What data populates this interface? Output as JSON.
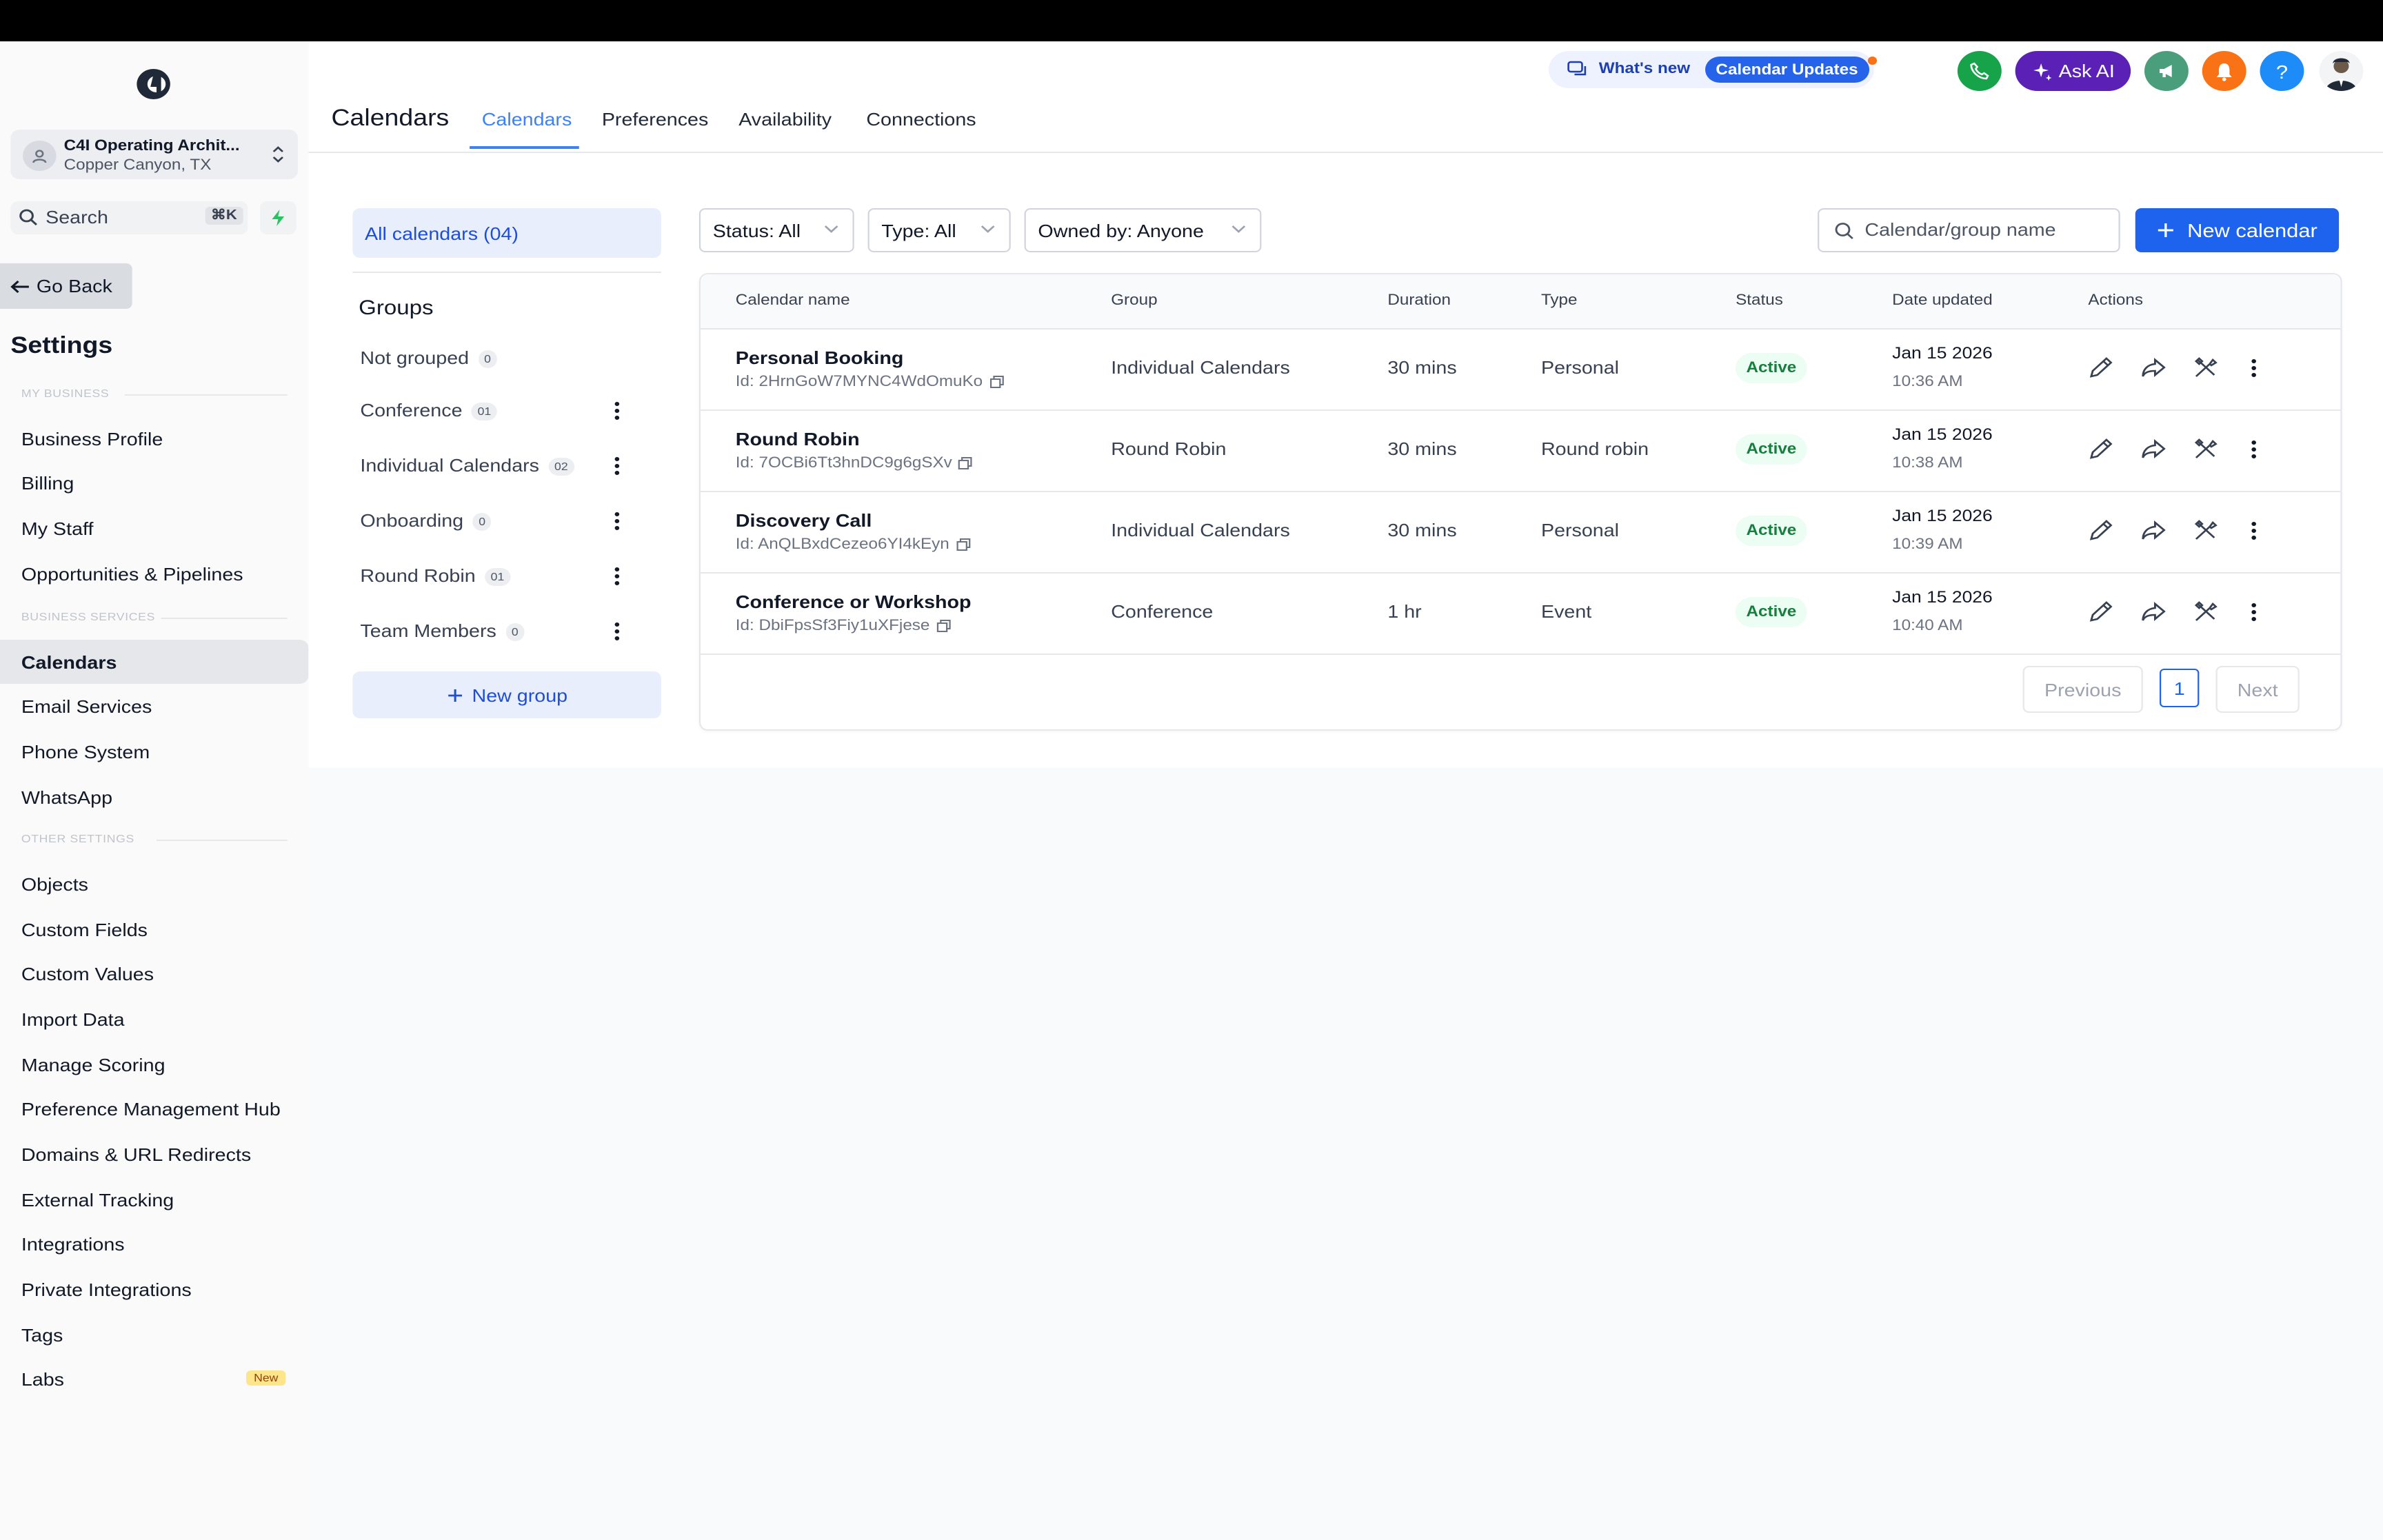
{
  "account": {
    "name": "C4I Operating Archit...",
    "location": "Copper Canyon, TX"
  },
  "search": {
    "label": "Search",
    "shortcut": "⌘K"
  },
  "sidebar": {
    "go_back": "Go Back",
    "title": "Settings",
    "sections": [
      {
        "label": "MY BUSINESS",
        "items": [
          "Business Profile",
          "Billing",
          "My Staff",
          "Opportunities & Pipelines"
        ]
      },
      {
        "label": "BUSINESS SERVICES",
        "items": [
          "Calendars",
          "Email Services",
          "Phone System",
          "WhatsApp"
        ]
      },
      {
        "label": "OTHER SETTINGS",
        "items": [
          "Objects",
          "Custom Fields",
          "Custom Values",
          "Import Data",
          "Manage Scoring",
          "Preference Management Hub",
          "Domains & URL Redirects",
          "External Tracking",
          "Integrations",
          "Private Integrations",
          "Tags",
          "Labs"
        ]
      }
    ],
    "active_item": "Calendars",
    "labs_badge": "New"
  },
  "header": {
    "page_title": "Calendars",
    "tabs": [
      "Calendars",
      "Preferences",
      "Availability",
      "Connections"
    ],
    "whats_new": "What's new",
    "updates_pill": "Calendar Updates",
    "ask_ai": "Ask AI",
    "help": "?"
  },
  "groups_panel": {
    "all_calendars": "All calendars (04)",
    "title": "Groups",
    "groups": [
      {
        "name": "Not grouped",
        "count": "0"
      },
      {
        "name": "Conference",
        "count": "01"
      },
      {
        "name": "Individual Calendars",
        "count": "02"
      },
      {
        "name": "Onboarding",
        "count": "0"
      },
      {
        "name": "Round Robin",
        "count": "01"
      },
      {
        "name": "Team Members",
        "count": "0"
      }
    ],
    "new_group": "New group"
  },
  "filters": {
    "status": "Status: All",
    "type": "Type: All",
    "owned_by": "Owned by: Anyone",
    "search_placeholder": "Calendar/group name",
    "new_calendar": "New calendar"
  },
  "table": {
    "columns": [
      "Calendar name",
      "Group",
      "Duration",
      "Type",
      "Status",
      "Date updated",
      "Actions"
    ],
    "rows": [
      {
        "name": "Personal Booking",
        "id": "Id: 2HrnGoW7MYNC4WdOmuKo",
        "group": "Individual Calendars",
        "duration": "30 mins",
        "type": "Personal",
        "status": "Active",
        "date": "Jan 15 2026",
        "time": "10:36 AM"
      },
      {
        "name": "Round Robin",
        "id": "Id: 7OCBi6Tt3hnDC9g6gSXv",
        "group": "Round Robin",
        "duration": "30 mins",
        "type": "Round robin",
        "status": "Active",
        "date": "Jan 15 2026",
        "time": "10:38 AM"
      },
      {
        "name": "Discovery Call",
        "id": "Id: AnQLBxdCezeo6YI4kEyn",
        "group": "Individual Calendars",
        "duration": "30 mins",
        "type": "Personal",
        "status": "Active",
        "date": "Jan 15 2026",
        "time": "10:39 AM"
      },
      {
        "name": "Conference or Workshop",
        "id": "Id: DbiFpsSf3Fiy1uXFjese",
        "group": "Conference",
        "duration": "1 hr",
        "type": "Event",
        "status": "Active",
        "date": "Jan 15 2026",
        "time": "10:40 AM"
      }
    ]
  },
  "pagination": {
    "previous": "Previous",
    "page": "1",
    "next": "Next"
  },
  "colors": {
    "accent": "#1d63ed",
    "status_active": "#15803d",
    "ask_ai": "#5b21b6",
    "phone": "#16a34a",
    "notification": "#f97316"
  },
  "icons": [
    "c4-logo-icon",
    "location-icon",
    "chevron-updown-icon",
    "search-icon",
    "bolt-icon",
    "arrow-left-icon",
    "chat-icon",
    "phone-icon",
    "sparkle-icon",
    "megaphone-icon",
    "bell-icon",
    "help-icon",
    "kebab-icon",
    "plus-icon",
    "chevron-down-icon",
    "copy-icon",
    "pencil-icon",
    "share-icon",
    "tools-icon"
  ]
}
